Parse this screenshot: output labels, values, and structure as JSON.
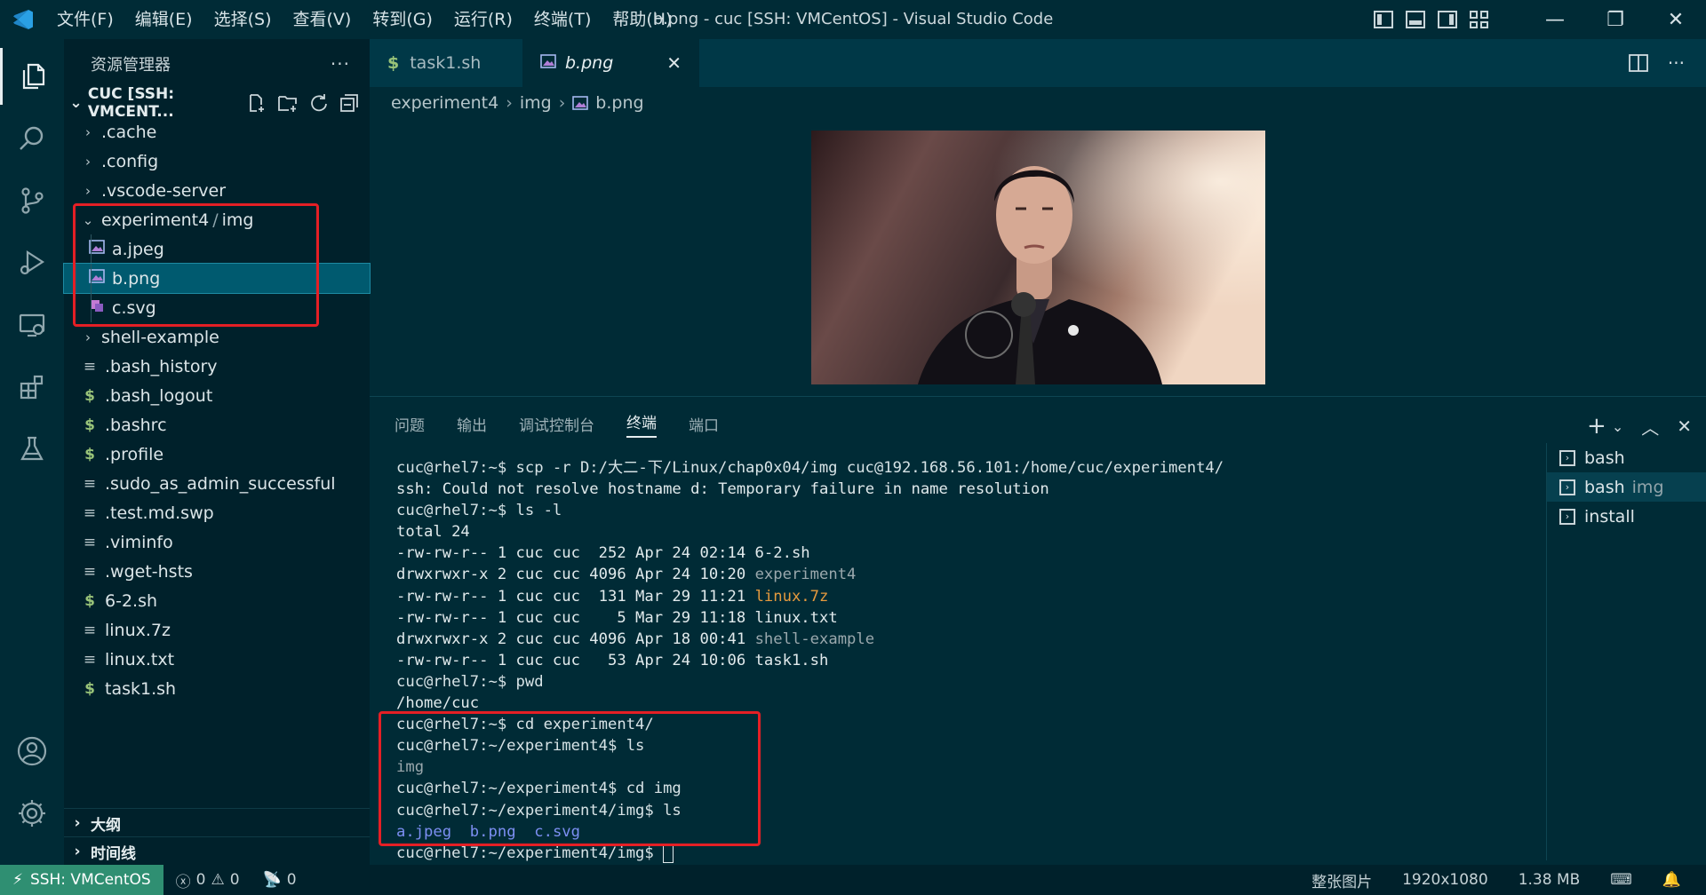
{
  "window": {
    "title": "b.png - cuc [SSH: VMCentOS] - Visual Studio Code",
    "menu": [
      "文件(F)",
      "编辑(E)",
      "选择(S)",
      "查看(V)",
      "转到(G)",
      "运行(R)",
      "终端(T)",
      "帮助(H)"
    ]
  },
  "sidebar": {
    "title": "资源管理器",
    "section": "CUC [SSH: VMCENT...",
    "tree": [
      {
        "label": ".cache",
        "kind": "folder"
      },
      {
        "label": ".config",
        "kind": "folder"
      },
      {
        "label": ".vscode-server",
        "kind": "folder"
      },
      {
        "label": "experiment4",
        "label2": "img",
        "kind": "folder-open"
      },
      {
        "label": "a.jpeg",
        "kind": "image"
      },
      {
        "label": "b.png",
        "kind": "image",
        "selected": true
      },
      {
        "label": "c.svg",
        "kind": "svg"
      },
      {
        "label": "shell-example",
        "kind": "folder"
      },
      {
        "label": ".bash_history",
        "kind": "text"
      },
      {
        "label": ".bash_logout",
        "kind": "shell"
      },
      {
        "label": ".bashrc",
        "kind": "shell"
      },
      {
        "label": ".profile",
        "kind": "shell"
      },
      {
        "label": ".sudo_as_admin_successful",
        "kind": "text"
      },
      {
        "label": ".test.md.swp",
        "kind": "text"
      },
      {
        "label": ".viminfo",
        "kind": "text"
      },
      {
        "label": ".wget-hsts",
        "kind": "text"
      },
      {
        "label": "6-2.sh",
        "kind": "shell"
      },
      {
        "label": "linux.7z",
        "kind": "text"
      },
      {
        "label": "linux.txt",
        "kind": "text"
      },
      {
        "label": "task1.sh",
        "kind": "shell"
      }
    ],
    "outline": "大纲",
    "timeline": "时间线"
  },
  "editor": {
    "tabs": [
      {
        "label": "task1.sh"
      },
      {
        "label": "b.png",
        "active": true
      }
    ],
    "breadcrumb": [
      "experiment4",
      "img",
      "b.png"
    ]
  },
  "panel": {
    "tabs": [
      "问题",
      "输出",
      "调试控制台",
      "终端",
      "端口"
    ],
    "active_tab": "终端",
    "terminals": [
      {
        "label": "bash",
        "sub": ""
      },
      {
        "label": "bash",
        "sub": "img",
        "active": true
      },
      {
        "label": "install",
        "sub": ""
      }
    ],
    "lines": [
      [
        {
          "t": "cuc@rhel7:~$ scp -r D:/大二-下/Linux/chap0x04/img cuc@192.168.56.101:/home/cuc/experiment4/",
          "c": "t-prompt"
        }
      ],
      [
        {
          "t": "ssh: Could not resolve hostname d: Temporary failure in name resolution",
          "c": ""
        }
      ],
      [
        {
          "t": "cuc@rhel7:~$ ls -l",
          "c": "t-prompt"
        }
      ],
      [
        {
          "t": "total 24",
          "c": ""
        }
      ],
      [
        {
          "t": "-rw-rw-r-- 1 cuc cuc  252 Apr 24 02:14 6-2.sh",
          "c": ""
        }
      ],
      [
        {
          "t": "drwxrwxr-x 2 cuc cuc 4096 Apr 24 10:20 ",
          "c": ""
        },
        {
          "t": "experiment4",
          "c": "t-dir"
        }
      ],
      [
        {
          "t": "-rw-rw-r-- 1 cuc cuc  131 Mar 29 11:21 ",
          "c": ""
        },
        {
          "t": "linux.7z",
          "c": "t-orange"
        }
      ],
      [
        {
          "t": "-rw-rw-r-- 1 cuc cuc    5 Mar 29 11:18 linux.txt",
          "c": ""
        }
      ],
      [
        {
          "t": "drwxrwxr-x 2 cuc cuc 4096 Apr 18 00:41 ",
          "c": ""
        },
        {
          "t": "shell-example",
          "c": "t-dir"
        }
      ],
      [
        {
          "t": "-rw-rw-r-- 1 cuc cuc   53 Apr 24 10:06 task1.sh",
          "c": ""
        }
      ],
      [
        {
          "t": "cuc@rhel7:~$ pwd",
          "c": "t-prompt"
        }
      ],
      [
        {
          "t": "/home/cuc",
          "c": ""
        }
      ],
      [
        {
          "t": "cuc@rhel7:~$ cd experiment4/",
          "c": "t-prompt"
        }
      ],
      [
        {
          "t": "cuc@rhel7:~/experiment4$ ls",
          "c": "t-prompt"
        }
      ],
      [
        {
          "t": "img",
          "c": "t-dir"
        }
      ],
      [
        {
          "t": "cuc@rhel7:~/experiment4$ cd img",
          "c": "t-prompt"
        }
      ],
      [
        {
          "t": "cuc@rhel7:~/experiment4/img$ ls",
          "c": "t-prompt"
        }
      ],
      [
        {
          "t": "a.jpeg",
          "c": "t-blue"
        },
        {
          "t": "  ",
          "c": ""
        },
        {
          "t": "b.png",
          "c": "t-blue"
        },
        {
          "t": "  ",
          "c": ""
        },
        {
          "t": "c.svg",
          "c": "t-blue"
        }
      ],
      [
        {
          "t": "cuc@rhel7:~/experiment4/img$ ",
          "c": "t-prompt"
        },
        {
          "t": "",
          "c": "cursor"
        }
      ]
    ]
  },
  "statusbar": {
    "remote": "SSH: VMCentOS",
    "errors": "0",
    "warnings": "0",
    "ports": "0",
    "image_mode": "整张图片",
    "image_size": "1920x1080",
    "file_size": "1.38 MB"
  },
  "colors": {
    "background": "#002b36",
    "sidebar": "#00212b",
    "selection": "#005a6f",
    "highlight_box": "#e51f25",
    "remote_indicator": "#2f8f72"
  }
}
